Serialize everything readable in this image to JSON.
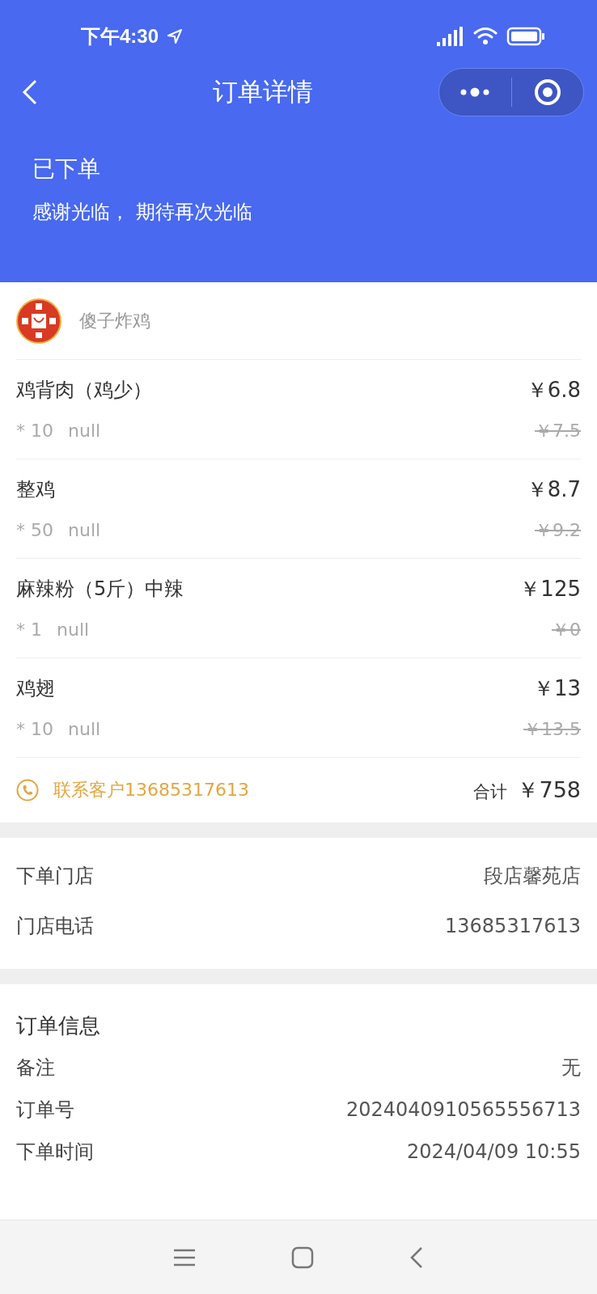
{
  "status_bar": {
    "time": "下午4:30"
  },
  "nav": {
    "title": "订单详情"
  },
  "header": {
    "status": "已下单",
    "message": "感谢光临， 期待再次光临"
  },
  "shop": {
    "name": "傻子炸鸡"
  },
  "items": [
    {
      "name": "鸡背肉（鸡少）",
      "quantity": "* 10",
      "spec": "null",
      "price": "￥6.8",
      "original_price": "￥7.5"
    },
    {
      "name": "整鸡",
      "quantity": "* 50",
      "spec": "null",
      "price": "￥8.7",
      "original_price": "￥9.2"
    },
    {
      "name": "麻辣粉（5斤）中辣",
      "quantity": "* 1",
      "spec": "null",
      "price": "￥125",
      "original_price": "￥0"
    },
    {
      "name": "鸡翅",
      "quantity": "* 10",
      "spec": "null",
      "price": "￥13",
      "original_price": "￥13.5"
    }
  ],
  "contact": {
    "label": "联系客户13685317613"
  },
  "total": {
    "label": "合计",
    "value": "￥758"
  },
  "store_info": [
    {
      "label": "下单门店",
      "value": "段店馨苑店"
    },
    {
      "label": "门店电话",
      "value": "13685317613"
    }
  ],
  "order_info": {
    "title": "订单信息",
    "rows": [
      {
        "label": "备注",
        "value": "无"
      },
      {
        "label": "订单号",
        "value": "2024040910565556713"
      },
      {
        "label": "下单时间",
        "value": "2024/04/09 10:55"
      }
    ]
  }
}
